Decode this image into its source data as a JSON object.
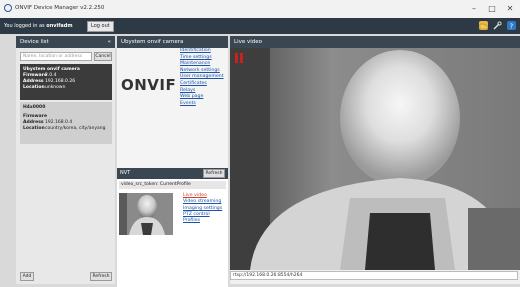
{
  "window": {
    "title": "ONVIF Device Manager v2.2.250",
    "controls": {
      "minimize": "–",
      "maximize": "□",
      "close": "✕"
    }
  },
  "topbar": {
    "logged_prefix": "You logged in as",
    "username": "onvifadm",
    "logout_label": "Log out",
    "icons": [
      "folder-icon",
      "tools-icon",
      "help-icon"
    ]
  },
  "device_list": {
    "title": "Device list",
    "collapse": "«",
    "search_placeholder": "Name, location or address",
    "cancel_label": "Cancel",
    "devices": [
      {
        "name": "Ubystem onvif camera",
        "firmware_label": "Firmware",
        "firmware": "2.0.4",
        "address_label": "Address",
        "address": "192.168.0.26",
        "location_label": "Location",
        "location": "unknown"
      },
      {
        "name": "H4x0000",
        "firmware_label": "Firmware",
        "firmware": "",
        "address_label": "Address",
        "address": "192.168.0.4",
        "location_label": "Location",
        "location": "country/korea, city/anyang"
      }
    ],
    "add_label": "Add",
    "refresh_label": "Refresh"
  },
  "device_panel": {
    "title": "Ubystem onvif camera",
    "logo_text": "ONVIF",
    "links": [
      "Identification",
      "Time settings",
      "Maintenance",
      "Network settings",
      "User management",
      "Certificates",
      "Relays",
      "Web page",
      "Events"
    ],
    "nvt": {
      "title": "NVT",
      "refresh_label": "Refresh",
      "profile_title": "video_src_token: CurrentProfile",
      "links": [
        "Live video",
        "Video streaming",
        "Imaging settings",
        "PTZ control",
        "Profiles"
      ]
    }
  },
  "live_video": {
    "title": "Live video",
    "url": "rtsp://192.168.0.26:8554/h264"
  },
  "colors": {
    "header_bg": "#3a4652",
    "topbar_bg": "#2d3a45",
    "link": "#1a53a8",
    "active_link": "#d2402a",
    "selected_device": "#3b3b3b",
    "pause_icon": "#c8221c"
  }
}
